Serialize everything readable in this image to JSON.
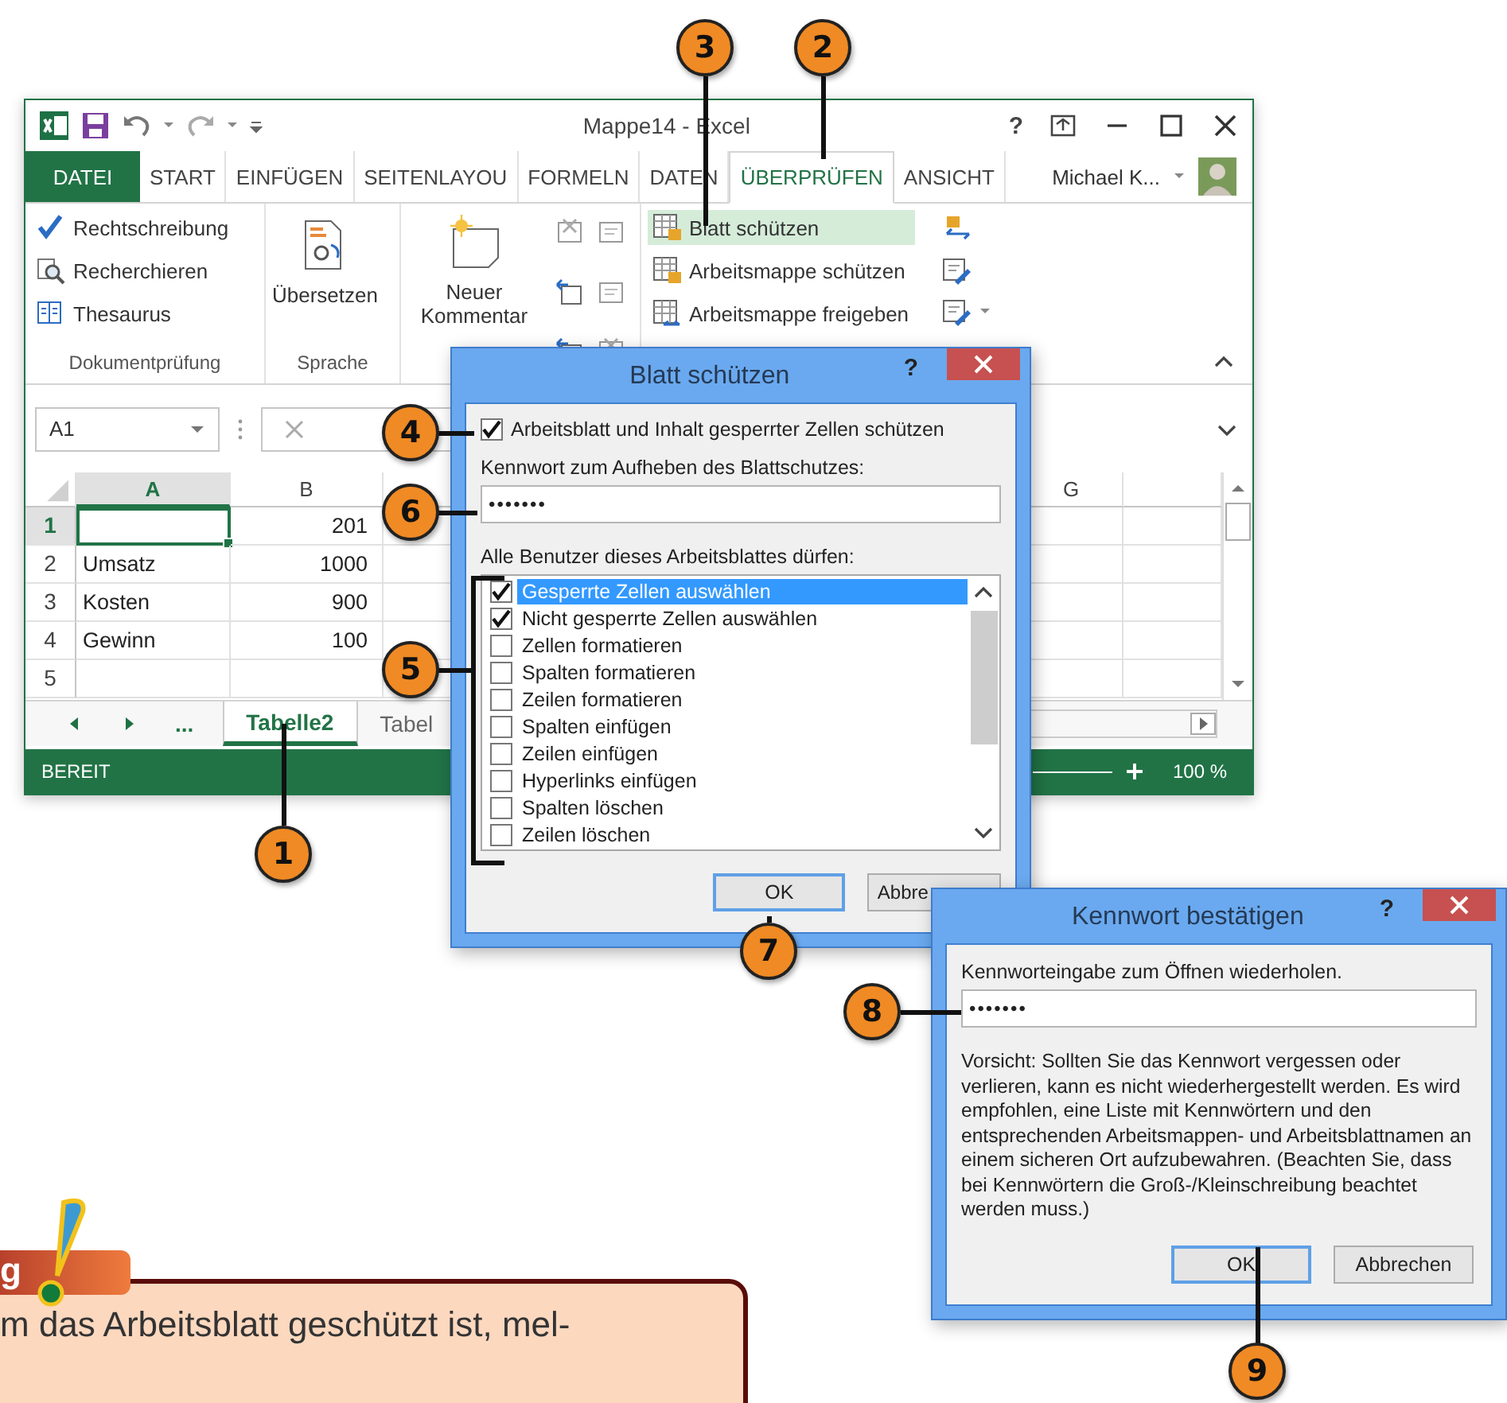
{
  "excel": {
    "title": "Mappe14 - Excel",
    "help": "?",
    "tabs": [
      {
        "label": "DATEI",
        "kind": "file",
        "selected": false
      },
      {
        "label": "START",
        "kind": "tab",
        "selected": false
      },
      {
        "label": "EINFÜGEN",
        "kind": "tab",
        "selected": false
      },
      {
        "label": "SEITENLAYOU",
        "kind": "tab",
        "selected": false
      },
      {
        "label": "FORMELN",
        "kind": "tab",
        "selected": false
      },
      {
        "label": "DATEN",
        "kind": "tab",
        "selected": false
      },
      {
        "label": "ÜBERPRÜFEN",
        "kind": "tab",
        "selected": true
      },
      {
        "label": "ANSICHT",
        "kind": "tab",
        "selected": false
      }
    ],
    "user": "Michael K...",
    "ribbon": [
      {
        "kind": "list",
        "label": "Dokumentprüfung",
        "items": [
          {
            "label": "Rechtschreibung",
            "selected": false
          },
          {
            "label": "Recherchieren",
            "selected": false
          },
          {
            "label": "Thesaurus",
            "selected": false
          }
        ]
      },
      {
        "kind": "large",
        "label": "Sprache",
        "items": [
          {
            "label": "Übersetzen"
          }
        ]
      },
      {
        "kind": "comments",
        "items": [
          {
            "label": "Neuer Kommentar"
          }
        ]
      },
      {
        "kind": "protect",
        "items": [
          {
            "label": "Blatt schützen",
            "selected": true
          },
          {
            "label": "Arbeitsmappe schützen",
            "selected": false
          },
          {
            "label": "Arbeitsmappe freigeben",
            "selected": false
          }
        ]
      }
    ],
    "name_box": "A1",
    "columns": [
      {
        "label": "A",
        "selected": true
      },
      {
        "label": "B",
        "selected": false
      },
      {
        "label": "G",
        "selected": false
      }
    ],
    "rows": [
      {
        "header": "1",
        "selected": true,
        "cells": [
          "",
          "201"
        ]
      },
      {
        "header": "2",
        "selected": false,
        "cells": [
          "Umsatz",
          "1000"
        ]
      },
      {
        "header": "3",
        "selected": false,
        "cells": [
          "Kosten",
          "900"
        ]
      },
      {
        "header": "4",
        "selected": false,
        "cells": [
          "Gewinn",
          "100"
        ]
      },
      {
        "header": "5",
        "selected": false,
        "cells": [
          "",
          ""
        ]
      }
    ],
    "sheet_overflow": "...",
    "sheets": [
      {
        "label": "Tabelle2",
        "selected": true
      },
      {
        "label": "Tabel",
        "selected": false
      }
    ],
    "status": "BEREIT",
    "zoom": "100 %"
  },
  "protect_dialog": {
    "title": "Blatt schützen",
    "help": "?",
    "protect": {
      "label": "Arbeitsblatt und Inhalt gesperrter Zellen schützen",
      "checked": true
    },
    "password_label": "Kennwort zum Aufheben des Blattschutzes:",
    "password": "•••••••",
    "list_label": "Alle Benutzer dieses Arbeitsblattes dürfen:",
    "permissions": [
      {
        "label": "Gesperrte Zellen auswählen",
        "checked": true,
        "selected": true
      },
      {
        "label": "Nicht gesperrte Zellen auswählen",
        "checked": true,
        "selected": false
      },
      {
        "label": "Zellen formatieren",
        "checked": false,
        "selected": false
      },
      {
        "label": "Spalten formatieren",
        "checked": false,
        "selected": false
      },
      {
        "label": "Zeilen formatieren",
        "checked": false,
        "selected": false
      },
      {
        "label": "Spalten einfügen",
        "checked": false,
        "selected": false
      },
      {
        "label": "Zeilen einfügen",
        "checked": false,
        "selected": false
      },
      {
        "label": "Hyperlinks einfügen",
        "checked": false,
        "selected": false
      },
      {
        "label": "Spalten löschen",
        "checked": false,
        "selected": false
      },
      {
        "label": "Zeilen löschen",
        "checked": false,
        "selected": false
      }
    ],
    "buttons": [
      {
        "label": "OK",
        "default": true
      },
      {
        "label": "Abbre",
        "default": false
      }
    ]
  },
  "confirm_dialog": {
    "title": "Kennwort bestätigen",
    "help": "?",
    "password_label": "Kennworteingabe zum Öffnen wiederholen.",
    "password": "•••••••",
    "warning": "Vorsicht: Sollten Sie das Kennwort vergessen oder verlieren, kann es nicht wiederhergestellt werden. Es wird empfohlen, eine Liste mit Kennwörtern und den entsprechenden Arbeitsmappen- und Arbeitsblattnamen an einem sicheren Ort aufzubewahren. (Beachten Sie, dass bei Kennwörtern die Groß-/Kleinschreibung beachtet werden muss.)",
    "buttons": [
      {
        "label": "OK",
        "default": true
      },
      {
        "label": "Abbrechen",
        "default": false
      }
    ]
  },
  "callouts": [
    {
      "number": "3"
    },
    {
      "number": "2"
    },
    {
      "number": "4"
    },
    {
      "number": "6"
    },
    {
      "number": "5"
    },
    {
      "number": "1"
    },
    {
      "number": "7"
    },
    {
      "number": "8"
    },
    {
      "number": "9"
    }
  ],
  "tip": {
    "heading": "g",
    "text": "m das Arbeitsblatt geschützt ist, mel-"
  }
}
